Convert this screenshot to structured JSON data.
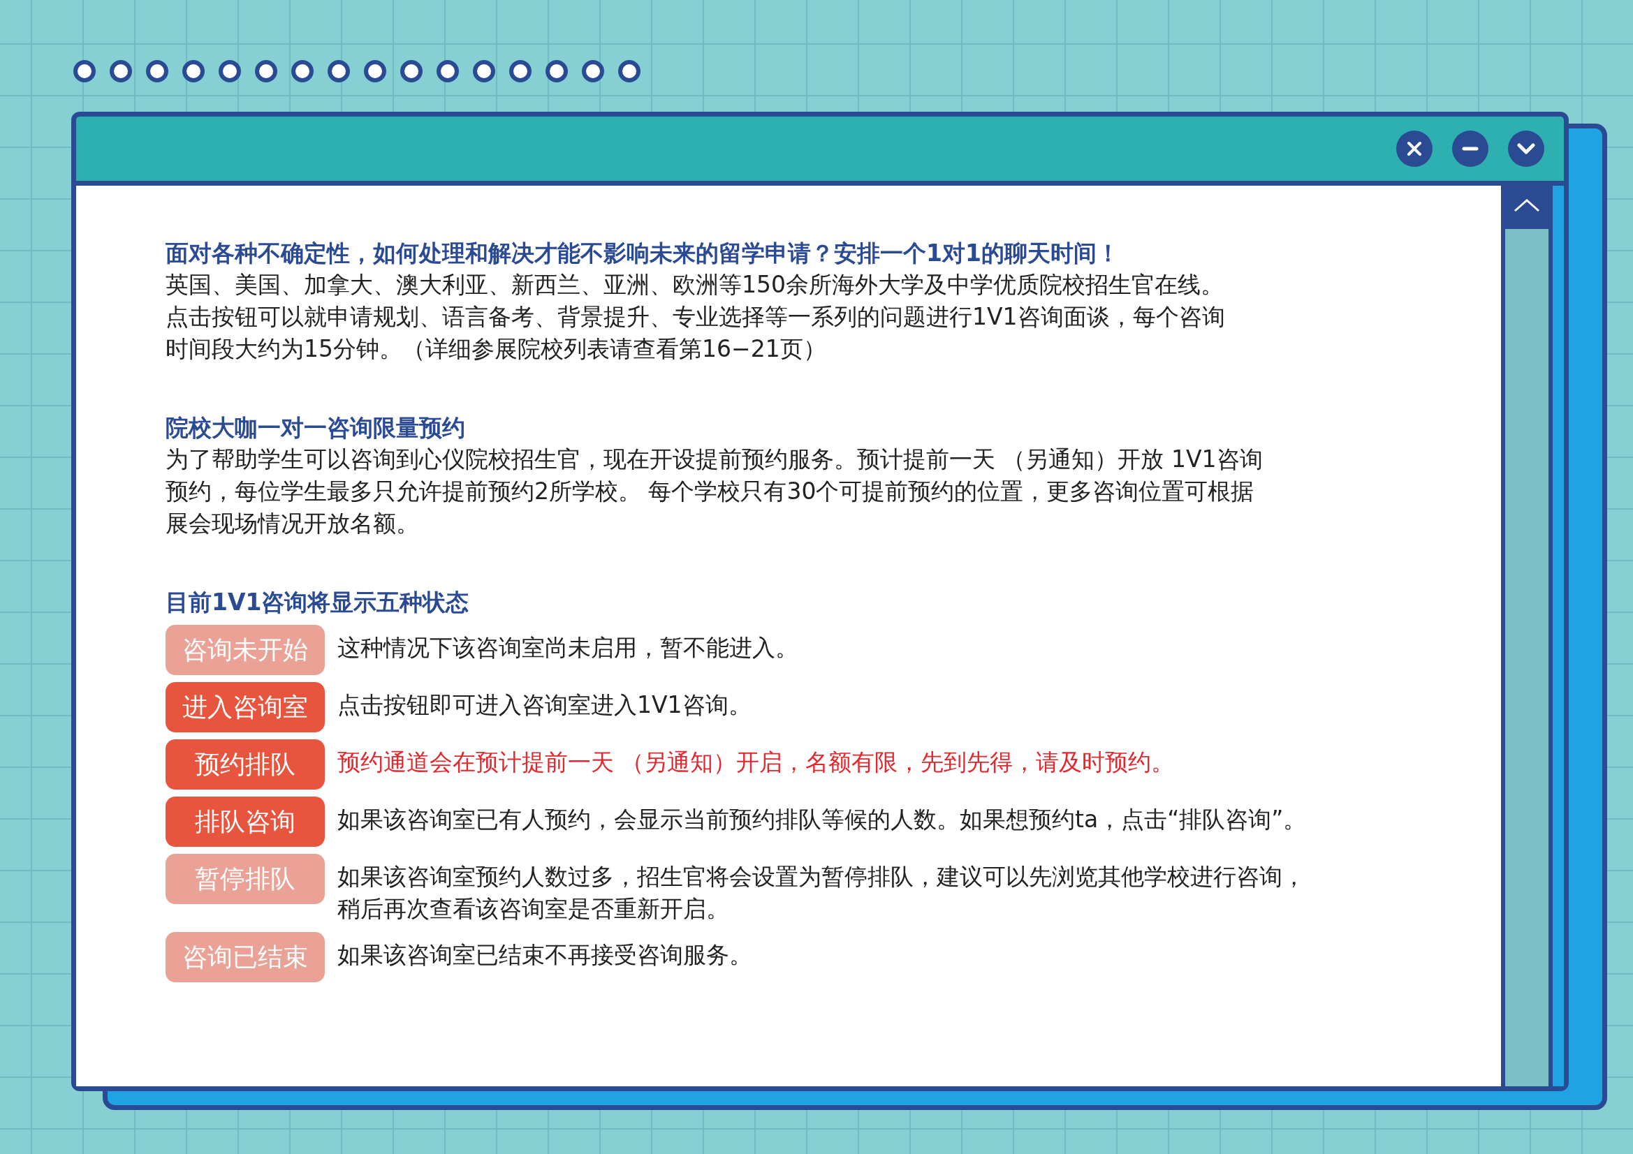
{
  "window": {
    "controls": [
      {
        "kind": "close"
      },
      {
        "kind": "minimize"
      },
      {
        "kind": "collapse"
      }
    ]
  },
  "sections": [
    {
      "heading": "面对各种不确定性，如何处理和解决才能不影响未来的留学申请？安排一个1对1的聊天时间！",
      "lines": [
        "英国、美国、加拿大、澳大利亚、新西兰、亚洲、欧洲等150余所海外大学及中学优质院校招生官在线。",
        "点击按钮可以就申请规划、语言备考、背景提升、专业选择等一系列的问题进行1V1咨询面谈，每个咨询",
        "时间段大约为15分钟。（详细参展院校列表请查看第16−21页）"
      ]
    },
    {
      "heading": "院校大咖一对一咨询限量预约",
      "lines": [
        "为了帮助学生可以咨询到心仪院校招生官，现在开设提前预约服务。预计提前一天 （另通知）开放 1V1咨询",
        "预约，每位学生最多只允许提前预约2所学校。 每个学校只有30个可提前预约的位置，更多咨询位置可根据",
        "展会现场情况开放名额。"
      ]
    }
  ],
  "statuses_heading": "目前1V1咨询将显示五种状态",
  "statuses": [
    {
      "badge": "咨询未开始",
      "disabled": true,
      "highlight": false,
      "lines": [
        "这种情况下该咨询室尚未启用，暂不能进入。"
      ]
    },
    {
      "badge": "进入咨询室",
      "disabled": false,
      "highlight": false,
      "lines": [
        "点击按钮即可进入咨询室进入1V1咨询。"
      ]
    },
    {
      "badge": "预约排队",
      "disabled": false,
      "highlight": true,
      "lines": [
        "预约通道会在预计提前一天 （另通知）开启，名额有限，先到先得，请及时预约。"
      ]
    },
    {
      "badge": "排队咨询",
      "disabled": false,
      "highlight": false,
      "lines": [
        "如果该咨询室已有人预约，会显示当前预约排队等候的人数。如果想预约ta，点击“排队咨询”。"
      ]
    },
    {
      "badge": "暂停排队",
      "disabled": true,
      "highlight": false,
      "lines": [
        "如果该咨询室预约人数过多，招生官将会设置为暂停排队，建议可以先浏览其他学校进行咨询，",
        "稍后再次查看该咨询室是否重新开启。"
      ]
    },
    {
      "badge": "咨询已结束",
      "disabled": true,
      "highlight": false,
      "lines": [
        "如果该咨询室已结束不再接受咨询服务。"
      ]
    }
  ]
}
